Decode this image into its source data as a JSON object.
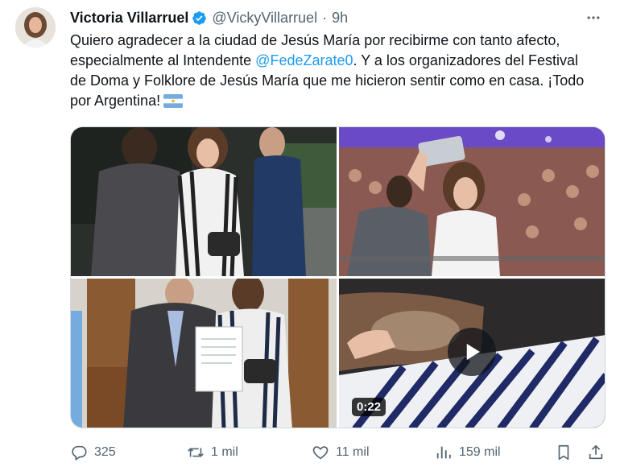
{
  "author": {
    "display_name": "Victoria Villarruel",
    "handle": "@VickyVillarruel",
    "separator": "·",
    "time": "9h",
    "verified_color": "#1d9bf0"
  },
  "tweet": {
    "text_before_mention": "Quiero agradecer a la ciudad de Jesús María por recibirme con tanto afecto, especialmente al Intendente ",
    "mention": "@FedeZarate0",
    "text_after_mention": ". Y a los organizadores del Festival de Doma y Folklore de Jesús María que me hicieron sentir como en casa. ¡Todo por Argentina!",
    "emoji": "flag-argentina",
    "mention_color": "#1d9bf0"
  },
  "media": {
    "video_duration": "0:22",
    "photos": [
      "photo-meeting-outdoor",
      "photo-selfie-crowd",
      "photo-document-signing",
      "video-thumbnail"
    ]
  },
  "actions": {
    "replies": "325",
    "retweets": "1 mil",
    "likes": "11 mil",
    "views": "159 mil"
  },
  "icons": [
    "verified-icon",
    "more-icon",
    "reply-icon",
    "retweet-icon",
    "like-icon",
    "views-icon",
    "bookmark-icon",
    "share-icon",
    "play-icon"
  ]
}
